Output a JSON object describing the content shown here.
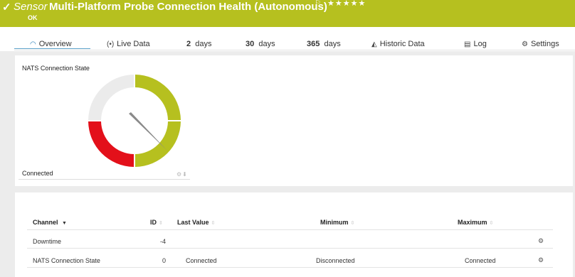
{
  "header": {
    "sensor_label": "Sensor",
    "sensor_name": "Multi-Platform Probe Connection Health (Autonomous)",
    "status": "OK",
    "priority_stars": "★★★★★",
    "check_icon": "check-icon",
    "flag_icon": "flag-icon",
    "brand_color": "#b6c01f"
  },
  "tabs": [
    {
      "label": "Overview",
      "icon": "gauge-icon",
      "active": true
    },
    {
      "label": "Live Data",
      "icon": "live-signal-icon"
    },
    {
      "number": "2",
      "label": "days"
    },
    {
      "number": "30",
      "label": "days"
    },
    {
      "number": "365",
      "label": "days"
    },
    {
      "label": "Historic Data",
      "icon": "area-chart-icon"
    },
    {
      "label": "Log",
      "icon": "log-icon"
    },
    {
      "label": "Settings",
      "icon": "gear-icon"
    }
  ],
  "gauge": {
    "title": "NATS Connection State",
    "value_label": "Connected",
    "colors": {
      "ok": "#b6c01f",
      "error": "#e3101a",
      "neutral": "#ebebeb"
    }
  },
  "table": {
    "columns": [
      "Channel",
      "ID",
      "Last Value",
      "Minimum",
      "Maximum"
    ],
    "rows": [
      {
        "channel": "Downtime",
        "id": "-4",
        "last_value": "",
        "minimum": "",
        "maximum": ""
      },
      {
        "channel": "NATS Connection State",
        "id": "0",
        "last_value": "Connected",
        "minimum": "Disconnected",
        "maximum": "Connected"
      }
    ]
  }
}
